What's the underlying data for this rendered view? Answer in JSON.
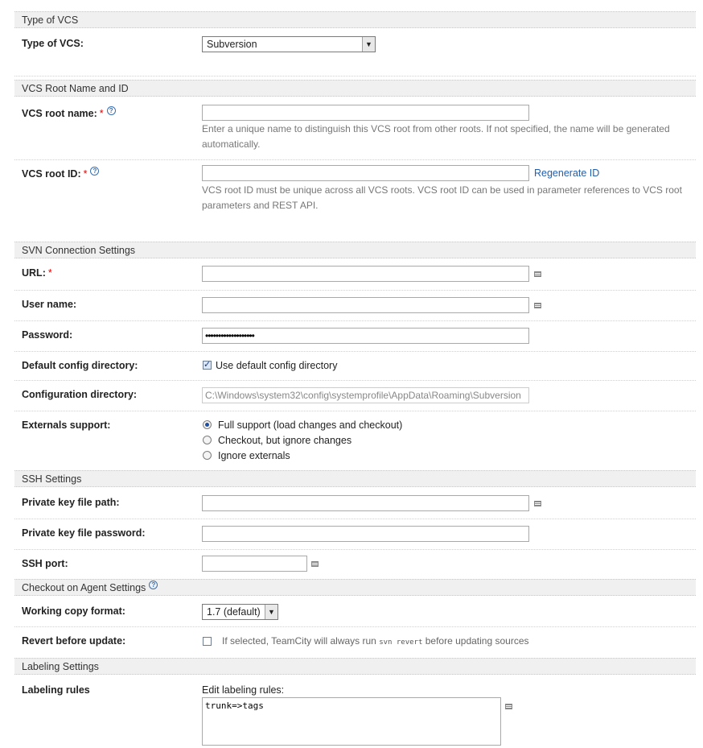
{
  "sections": {
    "type_of_vcs": "Type of VCS",
    "root_name_id": "VCS Root Name and ID",
    "svn_connection": "SVN Connection Settings",
    "ssh": "SSH Settings",
    "checkout_agent": "Checkout on Agent Settings",
    "labeling": "Labeling Settings"
  },
  "type_of_vcs": {
    "label": "Type of VCS:",
    "value": "Subversion"
  },
  "vcs_root_name": {
    "label": "VCS root name:",
    "required": "*",
    "value": "",
    "note": "Enter a unique name to distinguish this VCS root from other roots. If not specified, the name will be generated automatically."
  },
  "vcs_root_id": {
    "label": "VCS root ID:",
    "required": "*",
    "value": "",
    "regenerate": "Regenerate ID",
    "note": "VCS root ID must be unique across all VCS roots. VCS root ID can be used in parameter references to VCS root parameters and REST API."
  },
  "url": {
    "label": "URL:",
    "required": "*",
    "value": ""
  },
  "user_name": {
    "label": "User name:",
    "value": ""
  },
  "password": {
    "label": "Password:",
    "value": "•••••••••••••••••••"
  },
  "default_config": {
    "label": "Default config directory:",
    "checkbox_label": "Use default config directory",
    "checked": true
  },
  "config_dir": {
    "label": "Configuration directory:",
    "value": "C:\\Windows\\system32\\config\\systemprofile\\AppData\\Roaming\\Subversion"
  },
  "externals": {
    "label": "Externals support:",
    "options": [
      "Full support (load changes and checkout)",
      "Checkout, but ignore changes",
      "Ignore externals"
    ],
    "selected": 0
  },
  "private_key_path": {
    "label": "Private key file path:",
    "value": ""
  },
  "private_key_password": {
    "label": "Private key file password:",
    "value": ""
  },
  "ssh_port": {
    "label": "SSH port:",
    "value": ""
  },
  "working_copy": {
    "label": "Working copy format:",
    "value": "1.7 (default)"
  },
  "revert": {
    "label": "Revert before update:",
    "checked": false,
    "note_pre": "If selected, TeamCity will always run",
    "note_code": "svn revert",
    "note_post": "before updating sources"
  },
  "labeling_rules": {
    "label": "Labeling rules",
    "caption": "Edit labeling rules:",
    "value": "trunk=>tags"
  },
  "icons": {
    "help": "help-icon",
    "list": "list-icon",
    "dropdown": "chevron-down-icon"
  }
}
